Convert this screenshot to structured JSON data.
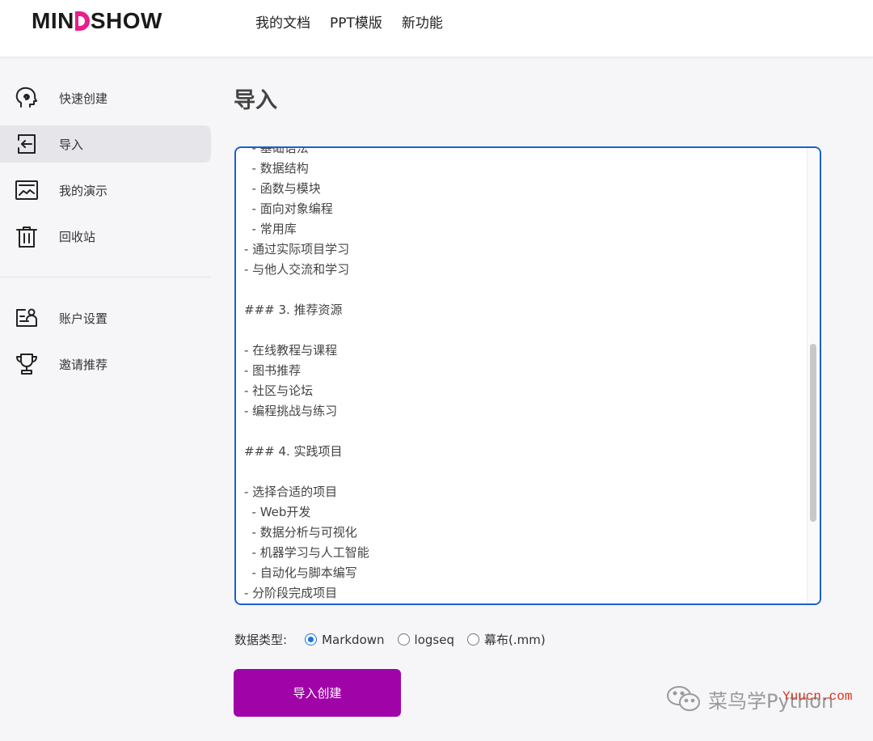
{
  "header": {
    "logo": {
      "left": "MIN",
      "right": "SHOW"
    },
    "nav": [
      "我的文档",
      "PPT模版",
      "新功能"
    ]
  },
  "sidebar": {
    "items": [
      {
        "label": "快速创建",
        "icon": "brain-icon"
      },
      {
        "label": "导入",
        "icon": "import-icon",
        "active": true
      },
      {
        "label": "我的演示",
        "icon": "presentation-icon"
      },
      {
        "label": "回收站",
        "icon": "trash-icon"
      },
      {
        "label": "账户设置",
        "icon": "account-icon"
      },
      {
        "label": "邀请推荐",
        "icon": "trophy-icon"
      }
    ]
  },
  "main": {
    "title": "导入",
    "editor_lines": [
      "  - 基础语法",
      "  - 数据结构",
      "  - 函数与模块",
      "  - 面向对象编程",
      "  - 常用库",
      "- 通过实际项目学习",
      "- 与他人交流和学习",
      "",
      "### 3. 推荐资源",
      "",
      "- 在线教程与课程",
      "- 图书推荐",
      "- 社区与论坛",
      "- 编程挑战与练习",
      "",
      "### 4. 实践项目",
      "",
      "- 选择合适的项目",
      "  - Web开发",
      "  - 数据分析与可视化",
      "  - 机器学习与人工智能",
      "  - 自动化与脚本编写",
      "- 分阶段完成项目"
    ],
    "data_type": {
      "label": "数据类型:",
      "options": [
        "Markdown",
        "logseq",
        "幕布(.mm)"
      ],
      "selected": "Markdown"
    },
    "submit_label": "导入创建"
  },
  "watermark": {
    "text": "菜鸟学Python",
    "site": "Yuucn.com"
  },
  "colors": {
    "brand": "#a004a8",
    "logo_accent": "#e91e8c",
    "focus": "#1a5fd0"
  }
}
